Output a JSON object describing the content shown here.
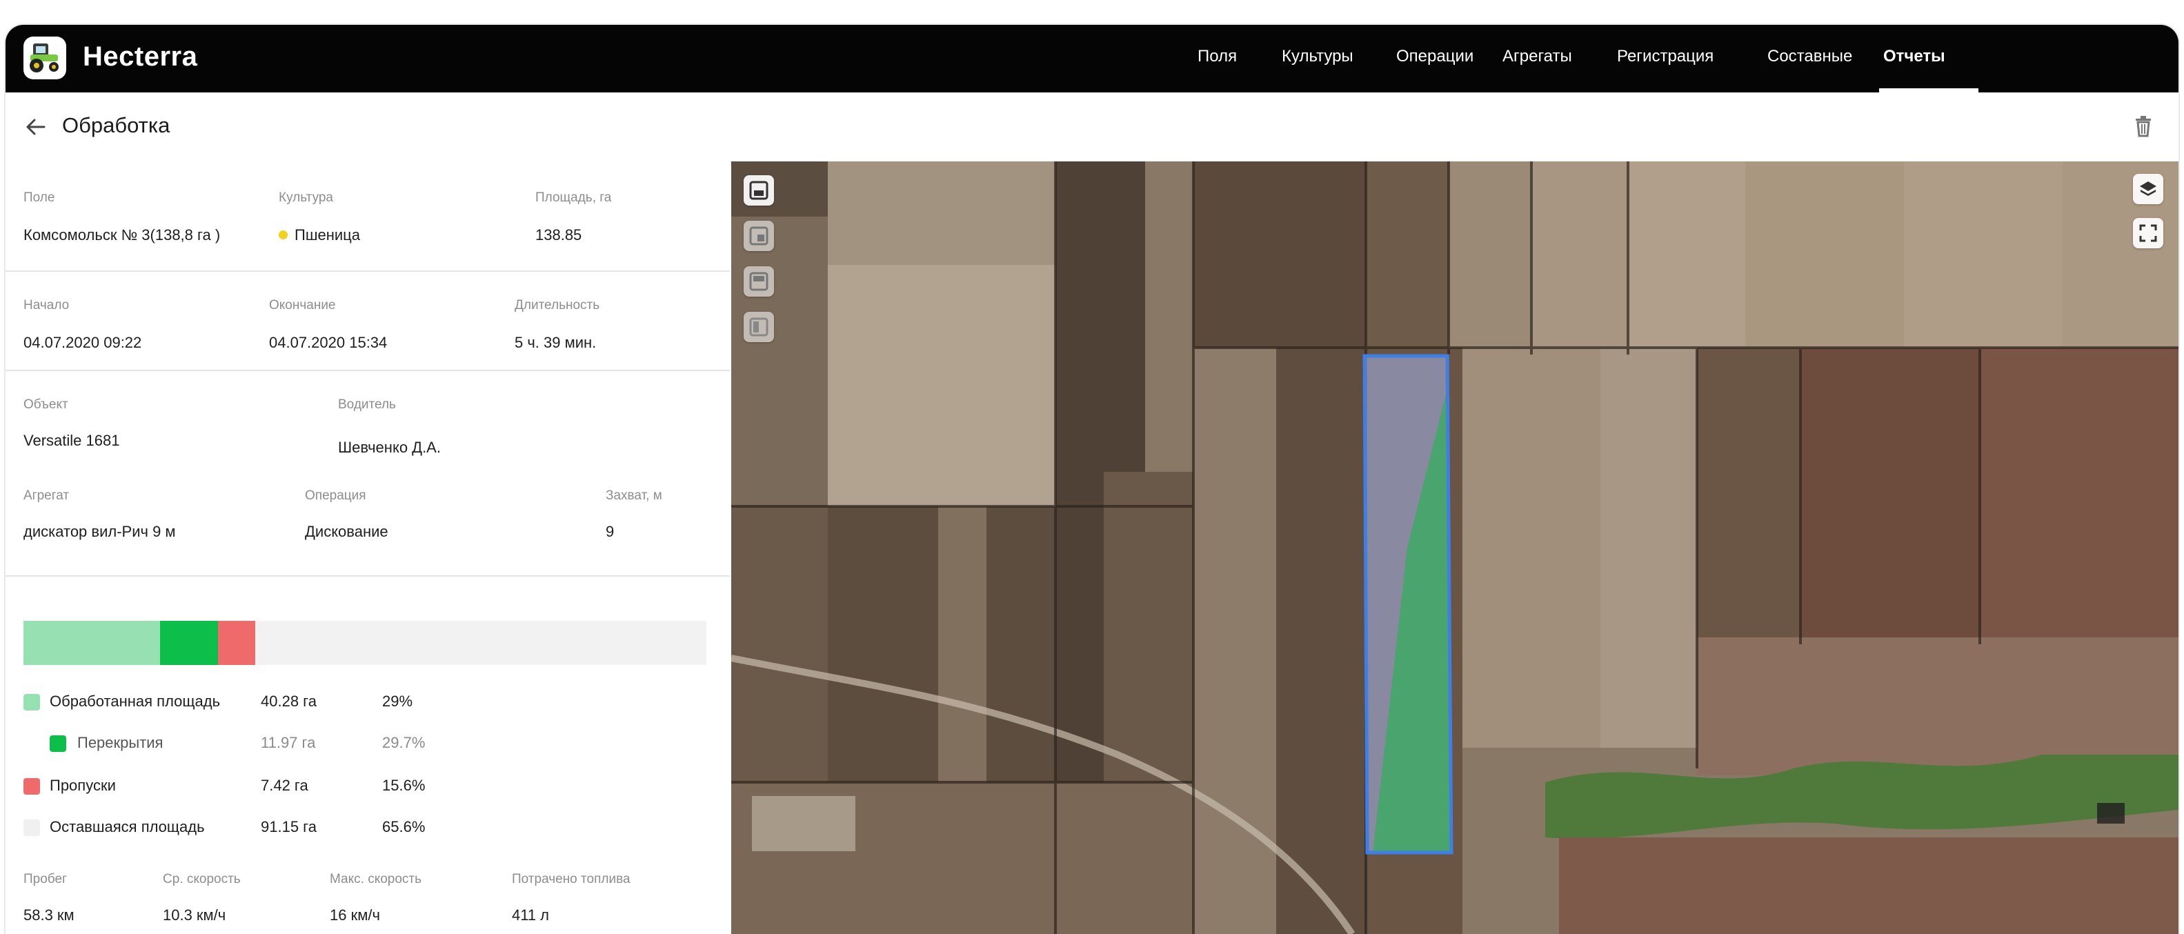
{
  "app": {
    "name": "Hecterra"
  },
  "nav": {
    "items": [
      {
        "label": "Поля"
      },
      {
        "label": "Культуры"
      },
      {
        "label": "Операции"
      },
      {
        "label": "Агрегаты"
      },
      {
        "label": "Регистрация"
      },
      {
        "label": "Составные"
      },
      {
        "label": "Отчеты"
      }
    ],
    "active": "Отчеты"
  },
  "page": {
    "title": "Обработка"
  },
  "info": {
    "field": {
      "label": "Поле",
      "value": "Комсомольск № 3(138,8 га )"
    },
    "crop": {
      "label": "Культура",
      "value": "Пшеница",
      "dot_color": "#f2d21c"
    },
    "area": {
      "label": "Площадь, га",
      "value": "138.85"
    },
    "start": {
      "label": "Начало",
      "value": "04.07.2020 09:22"
    },
    "end": {
      "label": "Окончание",
      "value": "04.07.2020 15:34"
    },
    "duration": {
      "label": "Длительность",
      "value": "5 ч. 39 мин."
    },
    "object": {
      "label": "Объект",
      "value": "Versatile 1681"
    },
    "driver": {
      "label": "Водитель",
      "value": "Шевченко Д.А."
    },
    "unit": {
      "label": "Агрегат",
      "value": "дискатор вил-Рич 9 м"
    },
    "operation": {
      "label": "Операция",
      "value": "Дискование"
    },
    "width": {
      "label": "Захват, м",
      "value": "9"
    }
  },
  "progress": {
    "segments": [
      {
        "name": "processed",
        "fraction": 0.2,
        "color": "#96e0b2"
      },
      {
        "name": "overlap",
        "fraction": 0.085,
        "color": "#0dbe4a"
      },
      {
        "name": "gaps",
        "fraction": 0.055,
        "color": "#ef6a6a"
      }
    ],
    "background": "#f2f2f2"
  },
  "legend": [
    {
      "name": "Обработанная площадь",
      "area": "40.28 га",
      "pct": "29%",
      "color": "#96e0b2"
    },
    {
      "name": "Перекрытия",
      "area": "11.97 га",
      "pct": "29.7%",
      "color": "#0dbe4a"
    },
    {
      "name": "Пропуски",
      "area": "7.42 га",
      "pct": "15.6%",
      "color": "#ef6a6a"
    },
    {
      "name": "Оставшаяся площадь",
      "area": "91.15 га",
      "pct": "65.6%",
      "color": "#f0f0f0"
    }
  ],
  "stats": {
    "mileage": {
      "label": "Пробег",
      "value": "58.3 км"
    },
    "avg_speed": {
      "label": "Ср. скорость",
      "value": "10.3 км/ч"
    },
    "max_speed": {
      "label": "Макс. скорость",
      "value": "16 км/ч"
    },
    "fuel": {
      "label": "Потрачено топлива",
      "value": "411 л"
    }
  },
  "map": {
    "left_tools": [
      "map-view-icon",
      "satellite-view-icon",
      "hybrid-view-icon",
      "terrain-view-icon"
    ],
    "right_tools": [
      "layers-icon",
      "fullscreen-icon"
    ],
    "track_color": "#3d7fe6"
  }
}
